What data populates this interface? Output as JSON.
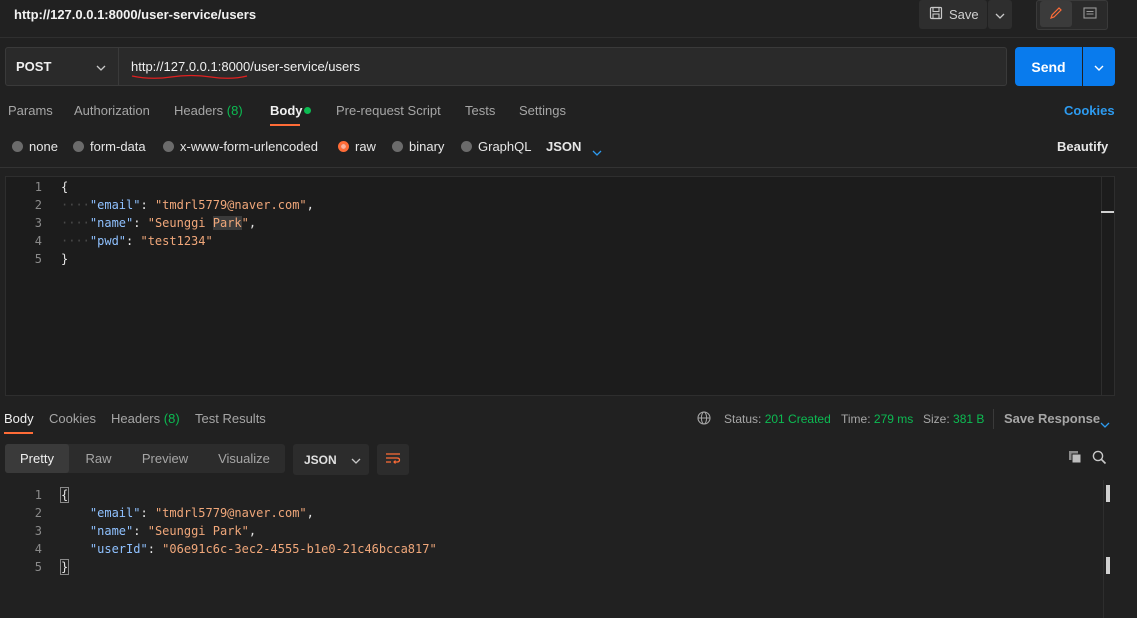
{
  "request": {
    "title": "http://127.0.0.1:8000/user-service/users",
    "save_label": "Save",
    "method": "POST",
    "url": "http://127.0.0.1:8000/user-service/users",
    "send_label": "Send"
  },
  "tabs": {
    "params": "Params",
    "authorization": "Authorization",
    "headers": "Headers",
    "headers_count": "(8)",
    "body": "Body",
    "prerequest": "Pre-request Script",
    "tests": "Tests",
    "settings": "Settings",
    "cookies": "Cookies"
  },
  "body_types": {
    "none": "none",
    "form_data": "form-data",
    "urlencoded": "x-www-form-urlencoded",
    "raw": "raw",
    "binary": "binary",
    "graphql": "GraphQL",
    "format": "JSON",
    "beautify": "Beautify",
    "selected": "raw"
  },
  "request_body": {
    "line_numbers": [
      "1",
      "2",
      "3",
      "4",
      "5"
    ],
    "open": "{",
    "close": "}",
    "email_key": "\"email\"",
    "email_val": "\"tmdrl5779@naver.com\"",
    "name_key": "\"name\"",
    "name_val_a": "\"Seunggi ",
    "name_val_b": "Park",
    "name_val_c": "\"",
    "pwd_key": "\"pwd\"",
    "pwd_val": "\"test1234\""
  },
  "response": {
    "tabs": {
      "body": "Body",
      "cookies": "Cookies",
      "headers": "Headers",
      "headers_count": "(8)",
      "test_results": "Test Results"
    },
    "status_label": "Status:",
    "status_value": "201 Created",
    "time_label": "Time:",
    "time_value": "279 ms",
    "size_label": "Size:",
    "size_value": "381 B",
    "save_response": "Save Response",
    "views": {
      "pretty": "Pretty",
      "raw": "Raw",
      "preview": "Preview",
      "visualize": "Visualize"
    },
    "format": "JSON"
  },
  "response_body": {
    "line_numbers": [
      "1",
      "2",
      "3",
      "4",
      "5"
    ],
    "open": "{",
    "close": "}",
    "email_key": "\"email\"",
    "email_val": "\"tmdrl5779@naver.com\"",
    "name_key": "\"name\"",
    "name_val": "\"Seunggi Park\"",
    "userid_key": "\"userId\"",
    "userid_val": "\"06e91c6c-3ec2-4555-b1e0-21c46bcca817\""
  },
  "colors": {
    "accent": "#ff6c37",
    "send": "#097bed",
    "link": "#2d9bf0",
    "success": "#0cbb52"
  }
}
